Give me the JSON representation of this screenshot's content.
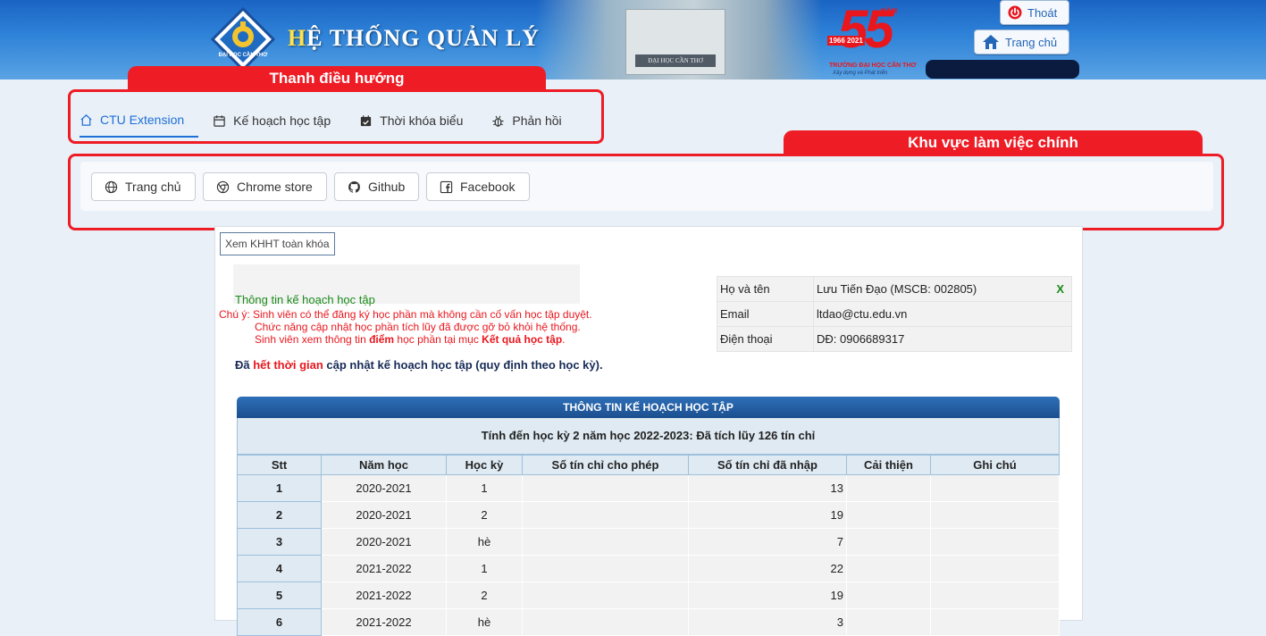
{
  "header": {
    "title_first": "H",
    "title_rest": "Ệ THỐNG QUẢN LÝ",
    "logo_text": "ĐẠI HỌC CẦN THƠ",
    "campus_sign": "ĐẠI HỌC CẦN THƠ",
    "anniversary_number": "55",
    "anniversary_nam": "NĂM",
    "anniversary_years": "1966 2021",
    "anniversary_sub": "TRƯỜNG ĐẠI HỌC CẦN THƠ",
    "anniversary_slogan": "Xây dựng và Phát triển",
    "logout_label": "Thoát",
    "home_label": "Trang chủ"
  },
  "annotations": {
    "nav_label": "Thanh điều hướng",
    "work_label": "Khu vực làm việc chính"
  },
  "nav": {
    "items": [
      {
        "label": "CTU Extension",
        "icon": "home-icon",
        "active": true
      },
      {
        "label": "Kế hoạch học tập",
        "icon": "calendar-icon"
      },
      {
        "label": "Thời khóa biểu",
        "icon": "calendar-check-icon"
      },
      {
        "label": "Phản hồi",
        "icon": "bug-icon"
      }
    ]
  },
  "work": {
    "buttons": [
      {
        "label": "Trang chủ",
        "icon": "globe-icon"
      },
      {
        "label": "Chrome store",
        "icon": "chrome-icon"
      },
      {
        "label": "Github",
        "icon": "github-icon"
      },
      {
        "label": "Facebook",
        "icon": "facebook-icon"
      }
    ]
  },
  "content": {
    "tab_label": "Xem KHHT toàn khóa",
    "info_title": "Thông tin kế hoạch học tập",
    "note_line1": "Chú ý: Sinh viên có thể đăng ký học phần mà không cần cố vấn học tập duyệt.",
    "note_line2": "Chức năng cập nhật học phần tích lũy đã được gỡ bỏ khỏi hệ thống.",
    "note_line3_a": "Sinh viên xem thông tin ",
    "note_line3_b": "điểm",
    "note_line3_c": " học phần tại mục ",
    "note_line3_d": "Kết quả học tập",
    "note_line3_e": ".",
    "deadline_a": "Đã ",
    "deadline_b": "hết thời gian",
    "deadline_c": " cập nhật kế hoạch học tập (quy định theo học kỳ)."
  },
  "student": {
    "name_label": "Họ và tên",
    "name_value": "Lưu Tiến Đạo (MSCB: 002805)",
    "close_label": "X",
    "email_label": "Email",
    "email_value": "ltdao@ctu.edu.vn",
    "phone_label": "Điện thoại",
    "phone_value": "DĐ: 0906689317"
  },
  "plan": {
    "title": "THÔNG TIN KẾ HOẠCH HỌC TẬP",
    "subtitle": "Tính đến học kỳ 2 năm học 2022-2023: Đã tích lũy 126 tín chỉ",
    "columns": [
      "Stt",
      "Năm học",
      "Học kỳ",
      "Số tín chỉ cho phép",
      "Số tín chỉ đã nhập",
      "Cải thiện",
      "Ghi chú"
    ],
    "rows": [
      {
        "stt": "1",
        "nam": "2020-2021",
        "hk": "1",
        "cho_phep": "",
        "da_nhap": "13",
        "cai_thien": "",
        "ghi_chu": ""
      },
      {
        "stt": "2",
        "nam": "2020-2021",
        "hk": "2",
        "cho_phep": "",
        "da_nhap": "19",
        "cai_thien": "",
        "ghi_chu": ""
      },
      {
        "stt": "3",
        "nam": "2020-2021",
        "hk": "hè",
        "cho_phep": "",
        "da_nhap": "7",
        "cai_thien": "",
        "ghi_chu": ""
      },
      {
        "stt": "4",
        "nam": "2021-2022",
        "hk": "1",
        "cho_phep": "",
        "da_nhap": "22",
        "cai_thien": "",
        "ghi_chu": ""
      },
      {
        "stt": "5",
        "nam": "2021-2022",
        "hk": "2",
        "cho_phep": "",
        "da_nhap": "19",
        "cai_thien": "",
        "ghi_chu": ""
      },
      {
        "stt": "6",
        "nam": "2021-2022",
        "hk": "hè",
        "cho_phep": "",
        "da_nhap": "3",
        "cai_thien": "",
        "ghi_chu": ""
      }
    ]
  },
  "colors": {
    "header_blue": "#1a64c4",
    "callout_red": "#ee1c25",
    "nav_active": "#1e6fd8",
    "table_header": "#1c4f8f"
  }
}
